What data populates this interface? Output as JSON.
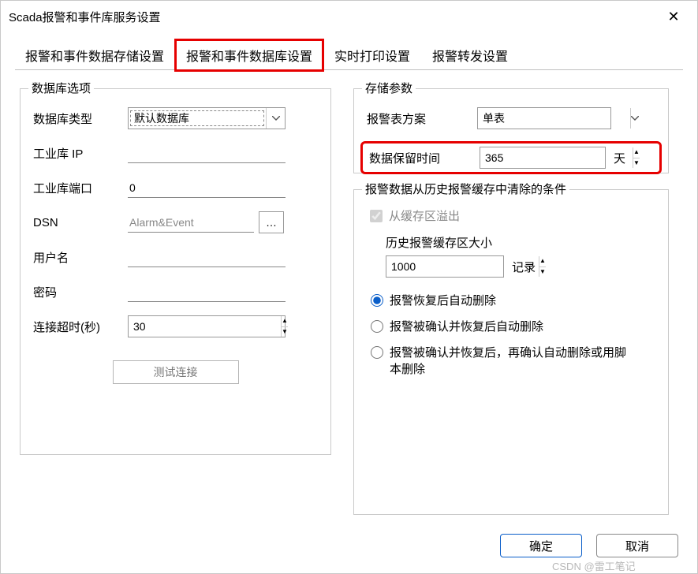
{
  "window": {
    "title": "Scada报警和事件库服务设置"
  },
  "tabs": {
    "items": [
      {
        "label": "报警和事件数据存储设置"
      },
      {
        "label": "报警和事件数据库设置"
      },
      {
        "label": "实时打印设置"
      },
      {
        "label": "报警转发设置"
      }
    ],
    "active_index": 1,
    "highlight_index": 1
  },
  "db_options": {
    "legend": "数据库选项",
    "db_type_label": "数据库类型",
    "db_type_value": "默认数据库",
    "ip_label": "工业库 IP",
    "ip_value": "",
    "port_label": "工业库端口",
    "port_value": "0",
    "dsn_label": "DSN",
    "dsn_value": "Alarm&Event",
    "user_label": "用户名",
    "user_value": "",
    "pwd_label": "密码",
    "pwd_value": "",
    "timeout_label": "连接超时(秒)",
    "timeout_value": "30",
    "test_btn": "测试连接"
  },
  "storage": {
    "legend": "存储参数",
    "scheme_label": "报警表方案",
    "scheme_value": "单表",
    "retention_label": "数据保留时间",
    "retention_value": "365",
    "retention_suffix": "天"
  },
  "purge": {
    "legend": "报警数据从历史报警缓存中清除的条件",
    "overflow_label": "从缓存区溢出",
    "cache_size_label": "历史报警缓存区大小",
    "cache_size_value": "1000",
    "cache_size_suffix": "记录",
    "radios": [
      {
        "label": "报警恢复后自动删除"
      },
      {
        "label": "报警被确认并恢复后自动删除"
      },
      {
        "label": "报警被确认并恢复后，再确认自动删除或用脚本删除"
      }
    ],
    "radio_selected": 0
  },
  "buttons": {
    "ok": "确定",
    "cancel": "取消"
  },
  "watermark": "CSDN @雷工笔记"
}
